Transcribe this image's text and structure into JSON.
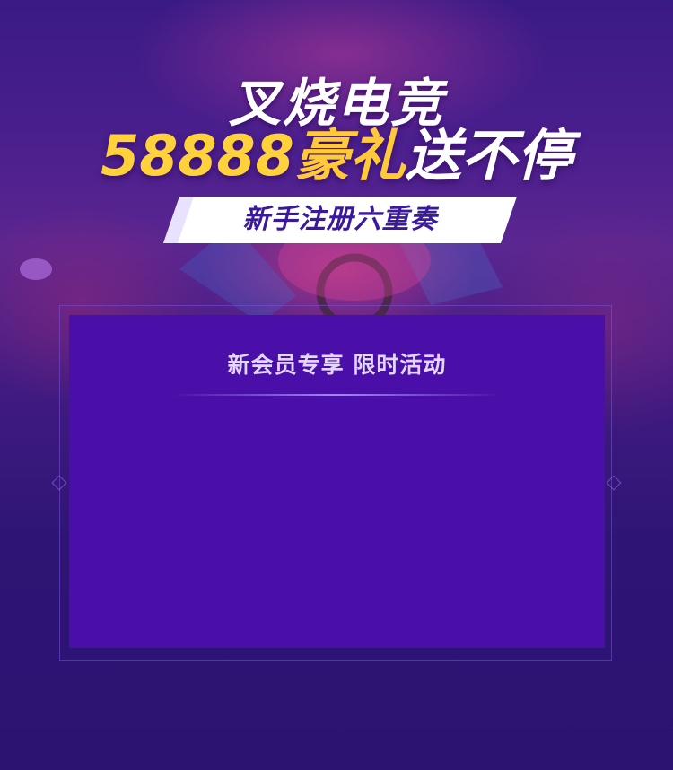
{
  "banner": {
    "title_line1": "叉烧电竞",
    "title_line2_number": "58888",
    "title_line2_gift": "豪礼",
    "title_line2_rest": "送不停",
    "ribbon_text": "新手注册六重奏"
  },
  "panel": {
    "title": "新会员专享 限时活动"
  },
  "colors": {
    "background": "#2d1474",
    "panel": "#4a0fa8",
    "highlight_yellow": "#ffd23c",
    "ribbon_text": "#3a1a9a"
  }
}
